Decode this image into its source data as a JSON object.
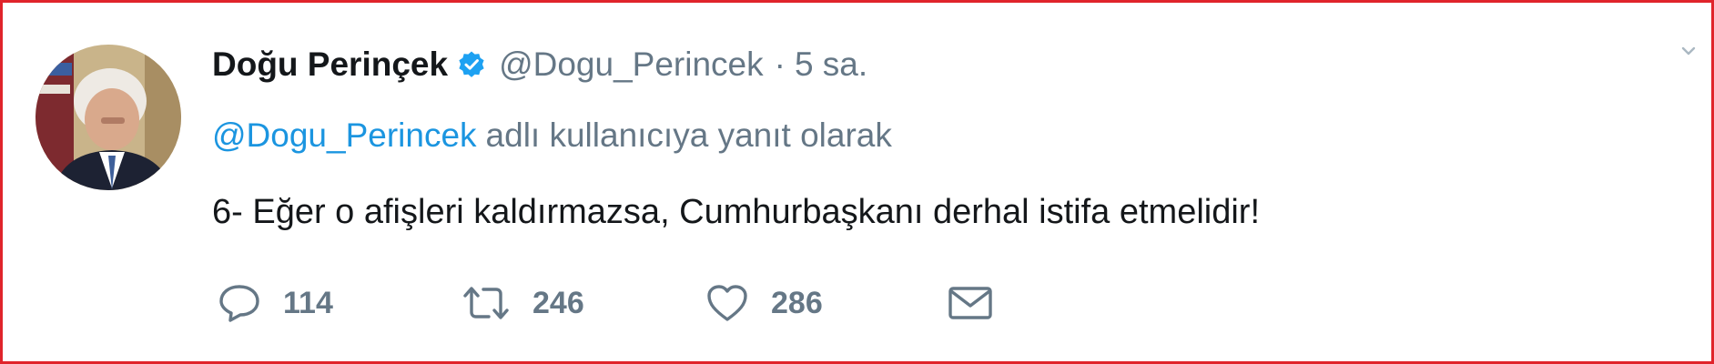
{
  "tweet": {
    "author": {
      "display_name": "Doğu Perinçek",
      "handle": "@Dogu_Perincek",
      "verified": true,
      "avatar_icon": "avatar-photo"
    },
    "separator": "·",
    "time": "5 sa.",
    "reply_to": {
      "mention": "@Dogu_Perincek",
      "suffix": "adlı kullanıcıya yanıt olarak"
    },
    "text": "6- Eğer o afişleri kaldırmazsa, Cumhurbaşkanı derhal istifa etmelidir!",
    "actions": {
      "reply": {
        "icon": "reply-icon",
        "count": "114"
      },
      "retweet": {
        "icon": "retweet-icon",
        "count": "246"
      },
      "like": {
        "icon": "heart-icon",
        "count": "286"
      },
      "message": {
        "icon": "envelope-icon"
      }
    }
  },
  "colors": {
    "border": "#e0242b",
    "link": "#1b95e0",
    "muted": "#657786",
    "text": "#14171a",
    "verified": "#1da1f2"
  }
}
